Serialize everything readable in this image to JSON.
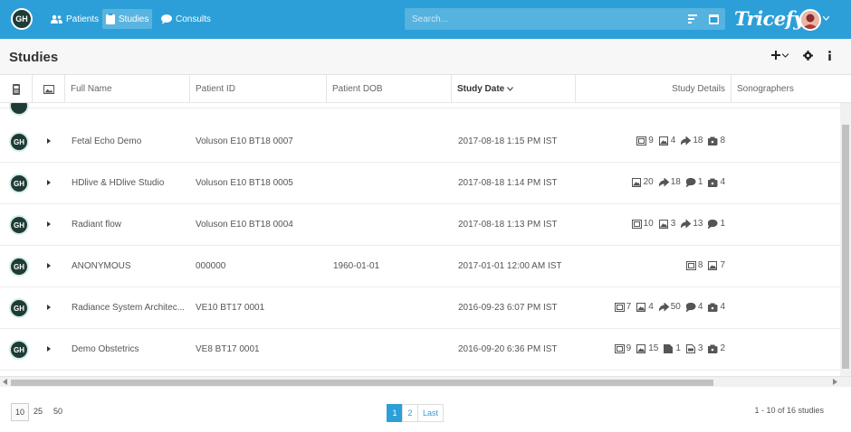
{
  "nav": {
    "logo": "GH",
    "items": [
      {
        "label": "Patients",
        "icon": "users-icon"
      },
      {
        "label": "Studies",
        "icon": "clipboard-icon",
        "active": true
      },
      {
        "label": "Consults",
        "icon": "chat-icon"
      }
    ],
    "search_placeholder": "Search...",
    "brand": "Tricefy"
  },
  "page": {
    "title": "Studies"
  },
  "table": {
    "headers": {
      "full_name": "Full Name",
      "patient_id": "Patient ID",
      "patient_dob": "Patient DOB",
      "study_date": "Study Date",
      "study_details": "Study Details",
      "sonographers": "Sonographers"
    },
    "rows": [
      {
        "avatar": "GH",
        "name": "Fetal Echo Demo",
        "patient_id": "Voluson E10 BT18 0007",
        "dob": "",
        "date": "2017-08-18 1:15 PM IST",
        "details": [
          {
            "icon": "film-icon",
            "n": "9"
          },
          {
            "icon": "image-icon",
            "n": "4"
          },
          {
            "icon": "share-icon",
            "n": "18"
          },
          {
            "icon": "camera-icon",
            "n": "8"
          }
        ]
      },
      {
        "avatar": "GH",
        "name": "HDlive & HDlive Studio",
        "patient_id": "Voluson E10 BT18 0005",
        "dob": "",
        "date": "2017-08-18 1:14 PM IST",
        "details": [
          {
            "icon": "image-icon",
            "n": "20"
          },
          {
            "icon": "share-icon",
            "n": "18"
          },
          {
            "icon": "comment-icon",
            "n": "1"
          },
          {
            "icon": "camera-icon",
            "n": "4"
          }
        ]
      },
      {
        "avatar": "GH",
        "name": "Radiant flow",
        "patient_id": "Voluson E10 BT18 0004",
        "dob": "",
        "date": "2017-08-18 1:13 PM IST",
        "details": [
          {
            "icon": "film-icon",
            "n": "10"
          },
          {
            "icon": "image-icon",
            "n": "3"
          },
          {
            "icon": "share-icon",
            "n": "13"
          },
          {
            "icon": "comment-icon",
            "n": "1"
          }
        ]
      },
      {
        "avatar": "GH",
        "name": "ANONYMOUS",
        "patient_id": "000000",
        "dob": "1960-01-01",
        "date": "2017-01-01 12:00 AM IST",
        "details": [
          {
            "icon": "film-icon",
            "n": "8"
          },
          {
            "icon": "image-icon",
            "n": "7"
          }
        ]
      },
      {
        "avatar": "GH",
        "name": "Radiance System Architec...",
        "patient_id": "VE10 BT17 0001",
        "dob": "",
        "date": "2016-09-23 6:07 PM IST",
        "details": [
          {
            "icon": "film-icon",
            "n": "7"
          },
          {
            "icon": "image-icon",
            "n": "4"
          },
          {
            "icon": "share-icon",
            "n": "50"
          },
          {
            "icon": "comment-icon",
            "n": "4"
          },
          {
            "icon": "camera-icon",
            "n": "4"
          }
        ]
      },
      {
        "avatar": "GH",
        "name": "Demo Obstetrics",
        "patient_id": "VE8 BT17 0001",
        "dob": "",
        "date": "2016-09-20 6:36 PM IST",
        "details": [
          {
            "icon": "film-icon",
            "n": "9"
          },
          {
            "icon": "image-icon",
            "n": "15"
          },
          {
            "icon": "document-icon",
            "n": "1"
          },
          {
            "icon": "pdf-icon",
            "n": "3"
          },
          {
            "icon": "camera-icon",
            "n": "2"
          }
        ]
      }
    ]
  },
  "footer": {
    "page_sizes": [
      "10",
      "25",
      "50"
    ],
    "pages": [
      "1",
      "2",
      "Last"
    ],
    "count": "1 - 10 of 16 studies"
  },
  "colors": {
    "primary": "#2c9fd8",
    "avatar": "#1f3b36"
  }
}
